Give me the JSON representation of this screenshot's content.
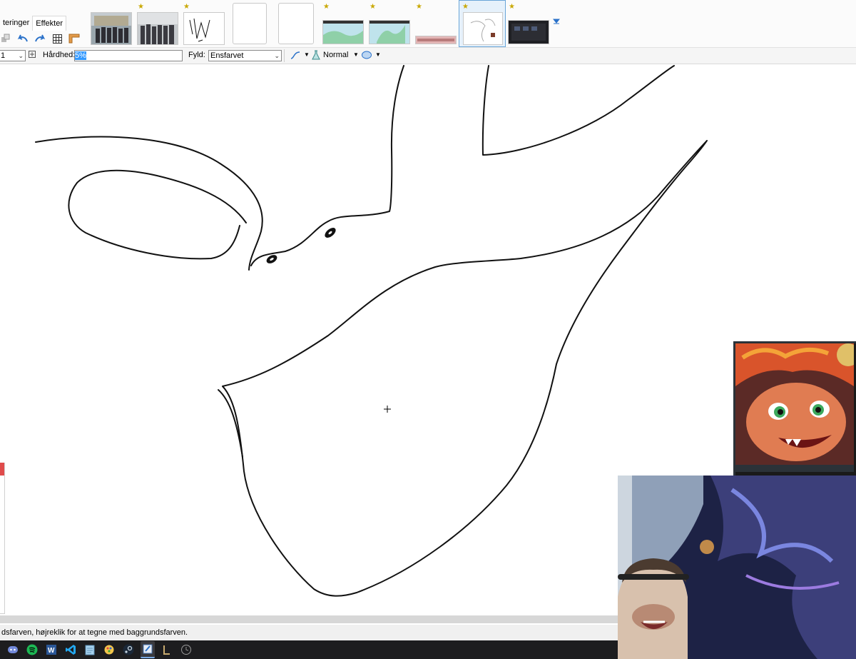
{
  "menu": {
    "items": [
      "teringer",
      "Effekter"
    ]
  },
  "colors": {
    "accent": "#3399ff",
    "canvas": "#ffffff",
    "taskbar": "#1d1d1f",
    "active_thumb": "#6aa5d8"
  },
  "thumbnails": [
    {
      "name": "photo-group-building",
      "starred": false
    },
    {
      "name": "photo-group-street",
      "starred": true
    },
    {
      "name": "sketch-strokes",
      "starred": true
    },
    {
      "name": "blank-canvas-1",
      "starred": false
    },
    {
      "name": "blank-canvas-2",
      "starred": false
    },
    {
      "name": "map-view-1",
      "starred": true
    },
    {
      "name": "map-view-2",
      "starred": true
    },
    {
      "name": "strip-image",
      "starred": true
    },
    {
      "name": "current-drawing",
      "starred": true,
      "active": true
    },
    {
      "name": "desktop-screenshot",
      "starred": true
    }
  ],
  "options": {
    "size_value": "1",
    "hardness_label": "Hårdhed:",
    "hardness_value": "5%",
    "fill_label": "Fyld:",
    "fill_value": "Ensfarvet",
    "blend_mode": "Normal"
  },
  "status": {
    "text": "dsfarven, højreklik for at tegne med baggrundsfarven."
  },
  "taskbar": {
    "icons": [
      "discord-icon",
      "spotify-icon",
      "word-icon",
      "vscode-icon",
      "notepad-icon",
      "paint-icon-2",
      "steam-icon",
      "paintdotnet-icon",
      "league-icon",
      "clock-icon"
    ]
  }
}
